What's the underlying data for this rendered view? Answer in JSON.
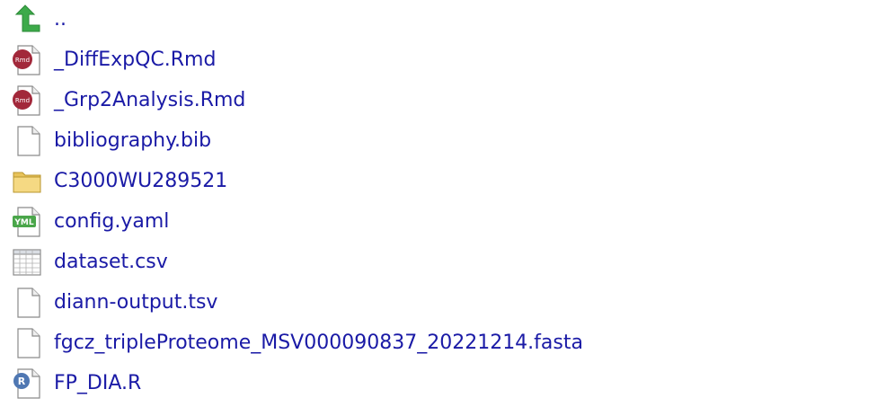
{
  "files": [
    {
      "name": "..",
      "icon": "go-up-arrow-icon"
    },
    {
      "name": "_DiffExpQC.Rmd",
      "icon": "rmd-file-icon"
    },
    {
      "name": "_Grp2Analysis.Rmd",
      "icon": "rmd-file-icon"
    },
    {
      "name": "bibliography.bib",
      "icon": "blank-file-icon"
    },
    {
      "name": "C3000WU289521",
      "icon": "folder-icon"
    },
    {
      "name": "config.yaml",
      "icon": "yaml-file-icon"
    },
    {
      "name": "dataset.csv",
      "icon": "csv-table-icon"
    },
    {
      "name": "diann-output.tsv",
      "icon": "blank-file-icon"
    },
    {
      "name": "fgcz_tripleProteome_MSV000090837_20221214.fasta",
      "icon": "blank-file-icon"
    },
    {
      "name": "FP_DIA.R",
      "icon": "r-script-icon"
    }
  ],
  "icon_labels": {
    "rmd": "Rmd",
    "yaml": "YML",
    "r": "R"
  },
  "colors": {
    "link_text": "#1a1aa6",
    "up_arrow": "#3daa4a",
    "folder": "#f1d27a",
    "rmd_badge": "#a2283a",
    "yaml_badge": "#4aa64a",
    "r_badge": "#4f77b2"
  }
}
